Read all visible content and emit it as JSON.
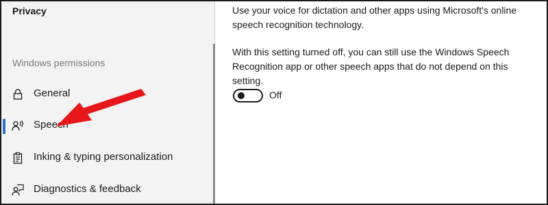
{
  "sidebar": {
    "title": "Privacy",
    "section_label": "Windows permissions",
    "items": [
      {
        "label": "General",
        "icon": "lock-icon"
      },
      {
        "label": "Speech",
        "icon": "speech-icon",
        "selected": true
      },
      {
        "label": "Inking & typing personalization",
        "icon": "clipboard-icon"
      },
      {
        "label": "Diagnostics & feedback",
        "icon": "feedback-icon"
      }
    ]
  },
  "main": {
    "paragraph1": "Use your voice for dictation and other apps using Microsoft's online speech recognition technology.",
    "paragraph2": "With this setting turned off, you can still use the Windows Speech Recognition app or other speech apps that do not depend on this setting.",
    "toggle": {
      "state_label": "Off",
      "on": false
    }
  },
  "colors": {
    "accent": "#2e6fd1",
    "annotation_arrow": "#e8171b"
  }
}
